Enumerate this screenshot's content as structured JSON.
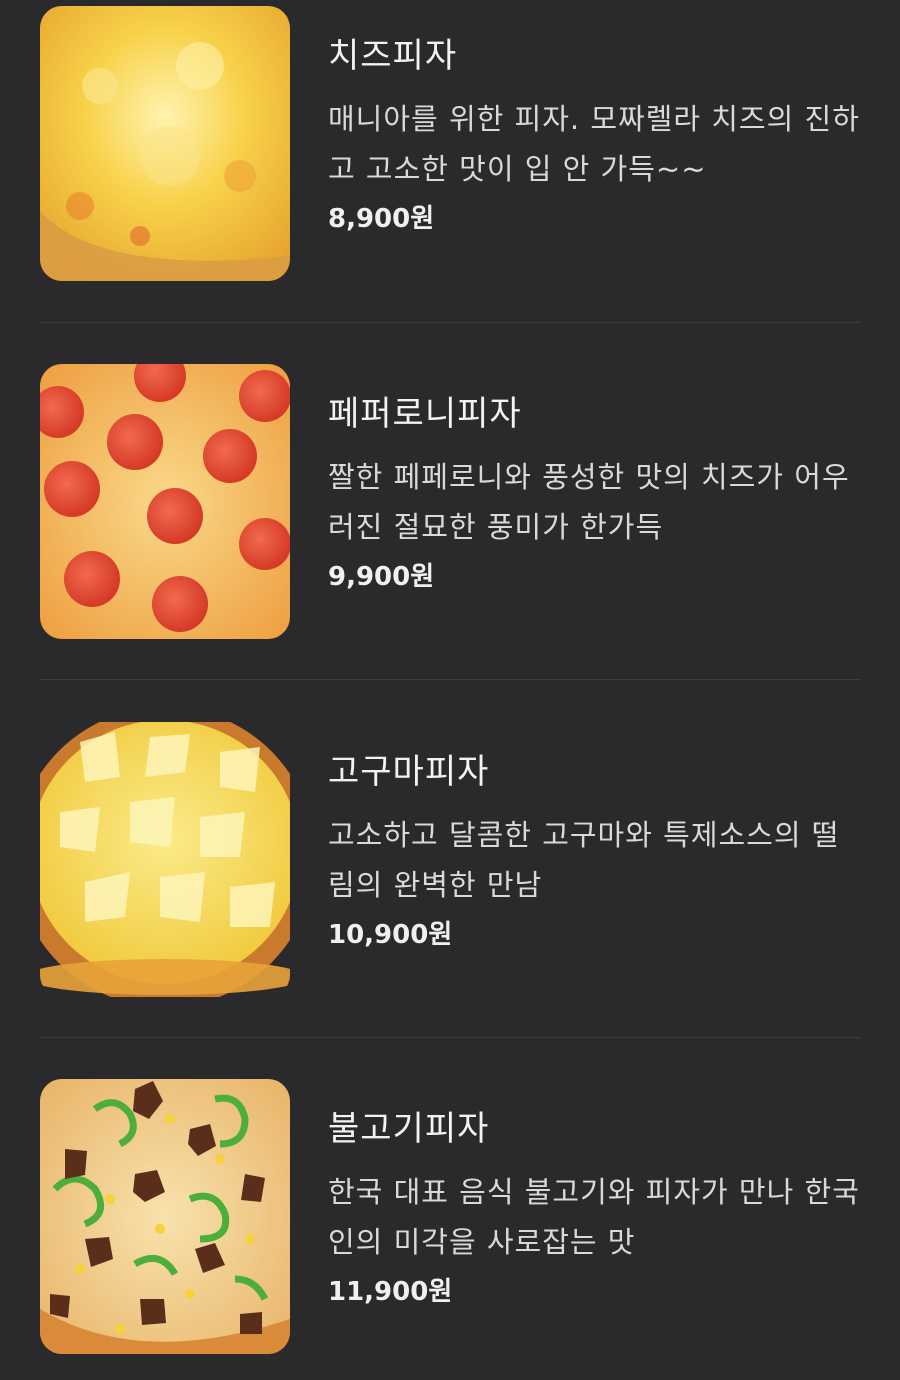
{
  "menu": {
    "items": [
      {
        "name": "치즈피자",
        "description": "매니아를 위한 피자. 모짜렐라 치즈의 진하고 고소한 맛이 입 안 가득~~",
        "price": "8,900원",
        "image": "cheese-pizza-photo",
        "colors": {
          "base": "#f5c23a",
          "highlight": "#fbe48a",
          "crust": "#d98a2b"
        }
      },
      {
        "name": "페퍼로니피자",
        "description": "짤한 페페로니와 풍성한 맛의 치즈가 어우러진 절묘한 풍미가 한가득",
        "price": "9,900원",
        "image": "pepperoni-pizza-photo",
        "colors": {
          "base": "#f2a23e",
          "highlight": "#f8cf7a",
          "topping": "#d9442f"
        }
      },
      {
        "name": "고구마피자",
        "description": "고소하고 달콤한 고구마와 특제소스의 떨림의 완벽한 만남",
        "price": "10,900원",
        "image": "sweet-potato-pizza-photo",
        "colors": {
          "base": "#f3d43a",
          "highlight": "#fbf0a0",
          "crust": "#c9742a"
        }
      },
      {
        "name": "불고기피자",
        "description": "한국 대표 음식 불고기와 피자가 만나 한국인의 미각을 사로잡는 맛",
        "price": "11,900원",
        "image": "bulgogi-pizza-photo",
        "colors": {
          "base": "#f0c67a",
          "highlight": "#f7e3b0",
          "meat": "#5a2e1a",
          "pepper": "#4caf3c"
        }
      }
    ]
  }
}
